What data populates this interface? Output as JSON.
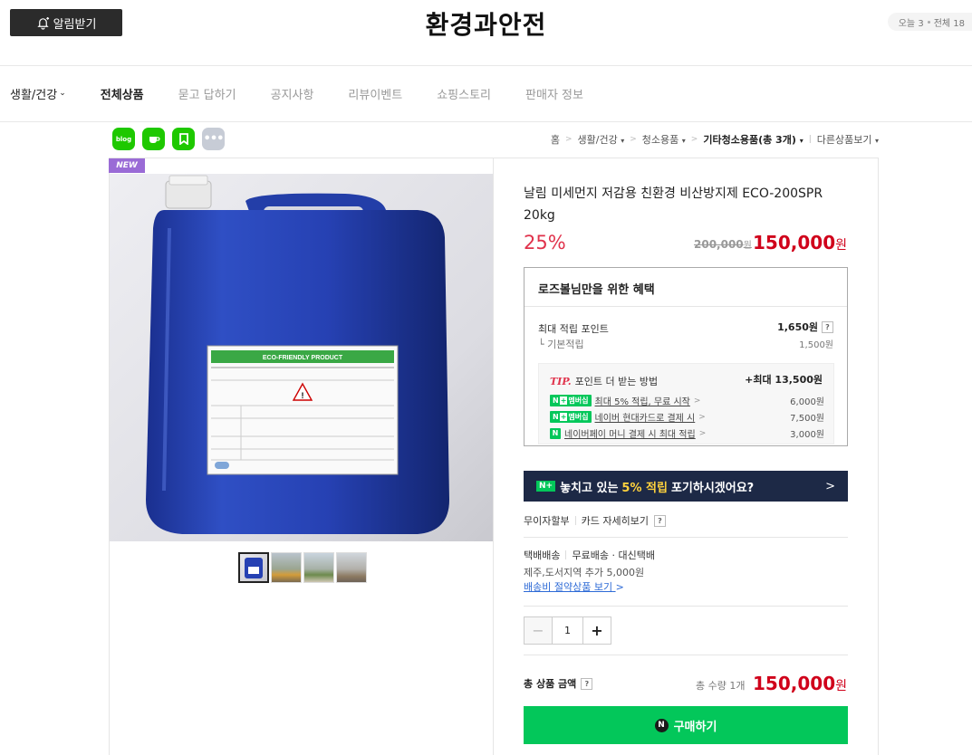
{
  "header": {
    "notify_label": "알림받기",
    "store_name": "환경과안전",
    "visit_today": "오늘 3",
    "visit_total": "전체 18"
  },
  "nav": {
    "category": "생활/건강",
    "items": [
      "전체상품",
      "묻고 답하기",
      "공지사항",
      "리뷰이벤트",
      "쇼핑스토리",
      "판매자 정보"
    ]
  },
  "share": {
    "blog": "blog",
    "cafe": "cafe",
    "keep": "keep",
    "more": "more"
  },
  "breadcrumb": {
    "home": "홈",
    "c1": "생활/건강",
    "c2": "청소용품",
    "c3": "기타청소용품(총 3개)",
    "other": "다른상품보기"
  },
  "product": {
    "badge": "NEW",
    "name": "날림 미세먼지 저감용 친환경 비산방지제 ECO-200SPR 20kg",
    "discount": "25%",
    "original_price": "200,000",
    "original_unit": "원",
    "sale_price": "150,000",
    "sale_unit": "원",
    "thumbnail_count": 4
  },
  "benefit": {
    "title": "로즈볼님만을 위한 혜택",
    "max_point_label": "최대 적립 포인트",
    "max_point_value": "1,650원",
    "base_label": "기본적립",
    "base_value": "1,500원",
    "tip_head": "TIP.",
    "tip_text": "포인트 더 받는 방법",
    "tip_max": "+최대 13,500원",
    "rows": [
      {
        "badge": "멤버십",
        "text": "최대 5% 적립, 무료 시작",
        "value": "6,000원"
      },
      {
        "badge": "멤버십",
        "text": "네이버 현대카드로 결제 시",
        "value": "7,500원"
      },
      {
        "badge": "",
        "text": "네이버페이 머니 결제 시 최대 적립",
        "value": "3,000원"
      }
    ]
  },
  "banner": {
    "pre": "놓치고 있는",
    "highlight": "5% 적립",
    "post": "포기하시겠어요?"
  },
  "card": {
    "installment": "무이자할부",
    "detail": "카드 자세히보기"
  },
  "shipping": {
    "method": "택배배송",
    "fee": "무료배송 · 대신택배",
    "extra": "제주,도서지역 추가 5,000원",
    "link": "배송비 절약상품 보기"
  },
  "quantity": {
    "value": "1"
  },
  "total": {
    "label": "총 상품 금액",
    "count": "총 수량 1개",
    "price": "150,000",
    "unit": "원"
  },
  "buy": {
    "label": "구매하기"
  },
  "colors": {
    "naver_green": "#03c75a",
    "price_red": "#d0021b",
    "banner_navy": "#1d2946"
  }
}
